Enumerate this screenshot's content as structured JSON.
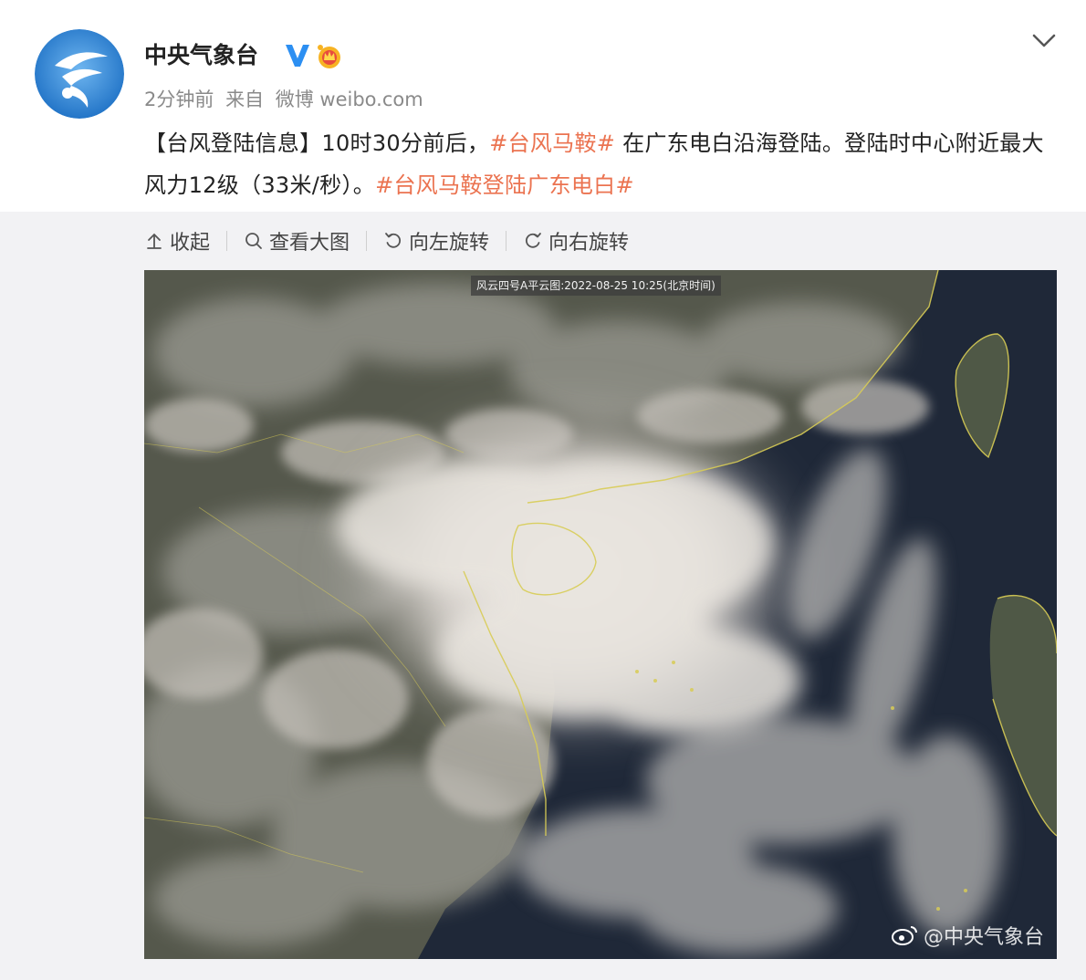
{
  "account": {
    "name": "中央气象台",
    "verified_icon": "verified-v-icon",
    "vip_icon": "crown-badge-icon"
  },
  "meta": {
    "time": "2分钟前",
    "source_prefix": "来自",
    "source": "微博 weibo.com"
  },
  "post": {
    "bracket_title": "【台风登陆信息】",
    "text_1": "10时30分前后，",
    "topic_1": "#台风马鞍#",
    "text_2": " 在广东电白沿海登陆。登陆时中心附近最大风力12级（33米/秒）。",
    "topic_2": "#台风马鞍登陆广东电白#"
  },
  "toolbar": {
    "collapse": "收起",
    "view_large": "查看大图",
    "rotate_left": "向左旋转",
    "rotate_right": "向右旋转"
  },
  "image": {
    "caption": "风云四号A平云图:2022-08-25 10:25(北京时间)",
    "watermark": "@中央气象台"
  },
  "colors": {
    "topic": "#eb7350",
    "verified": "#2c8ff2",
    "background": "#f2f2f4"
  }
}
